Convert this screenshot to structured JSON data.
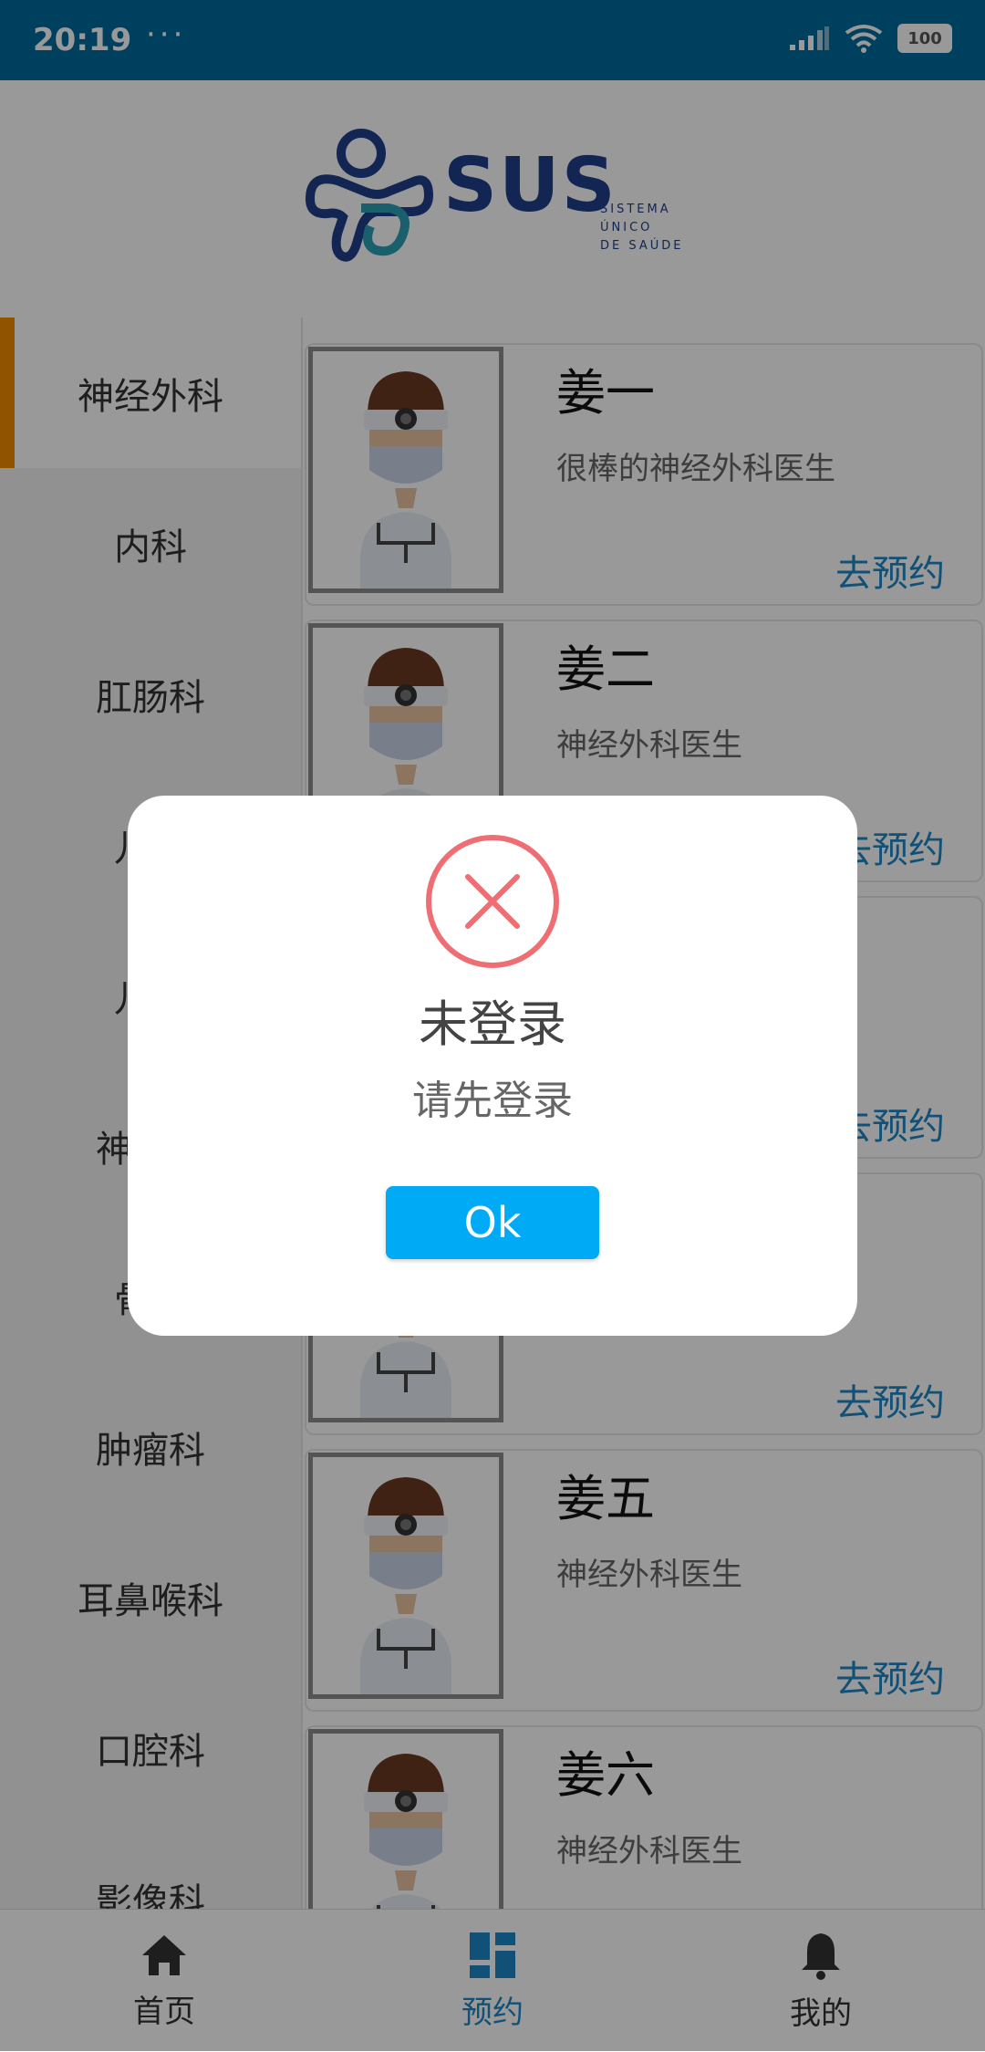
{
  "status_bar": {
    "time": "20:19",
    "dots": "···",
    "battery": "100"
  },
  "header": {
    "logo_text": "SUS",
    "logo_sub": [
      "SISTEMA",
      "ÚNICO",
      "DE SAÚDE"
    ]
  },
  "sidebar": {
    "items": [
      {
        "label": "神经外科"
      },
      {
        "label": "内科"
      },
      {
        "label": "肛肠科"
      },
      {
        "label": "儿科"
      },
      {
        "label": "儿科"
      },
      {
        "label": "神经科"
      },
      {
        "label": "骨科"
      },
      {
        "label": "肿瘤科"
      },
      {
        "label": "耳鼻喉科"
      },
      {
        "label": "口腔科"
      },
      {
        "label": "影像科"
      }
    ]
  },
  "doctors": [
    {
      "name": "姜一",
      "desc": "很棒的神经外科医生",
      "action": "去预约"
    },
    {
      "name": "姜二",
      "desc": "神经外科医生",
      "action": "去预约"
    },
    {
      "name": "",
      "desc": "",
      "action": "去预约"
    },
    {
      "name": "",
      "desc": "",
      "action": "去预约"
    },
    {
      "name": "姜五",
      "desc": "神经外科医生",
      "action": "去预约"
    },
    {
      "name": "姜六",
      "desc": "神经外科医生",
      "action": ""
    }
  ],
  "bottom_nav": {
    "items": [
      {
        "label": "首页",
        "icon": "home-icon"
      },
      {
        "label": "预约",
        "icon": "grid-icon"
      },
      {
        "label": "我的",
        "icon": "bell-icon"
      }
    ]
  },
  "dialog": {
    "title": "未登录",
    "message": "请先登录",
    "ok_label": "Ok",
    "icon": "error-x-icon",
    "icon_color": "#ee6e73"
  },
  "colors": {
    "status_bar": "#006b9e",
    "accent": "#f08c00",
    "link": "#1e88c7",
    "ok_button": "#00aaf5",
    "brand": "#1e3f8a"
  }
}
